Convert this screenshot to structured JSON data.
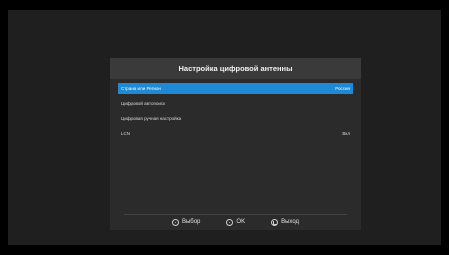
{
  "dialog": {
    "title": "Настройка цифровой антенны"
  },
  "menu": {
    "items": [
      {
        "label": "Страна или Регион",
        "value": "Россия"
      },
      {
        "label": "Цифровой автопоиск",
        "value": ""
      },
      {
        "label": "Цифровая ручная настройка",
        "value": ""
      },
      {
        "label": "LCN",
        "value": "Вкл"
      }
    ]
  },
  "footer": {
    "select_label": "Выбор",
    "ok_label": "OK",
    "exit_label": "Выход"
  },
  "colors": {
    "accent": "#1e8ad6",
    "panel": "#2b2b2b",
    "header": "#3a3a3a"
  }
}
